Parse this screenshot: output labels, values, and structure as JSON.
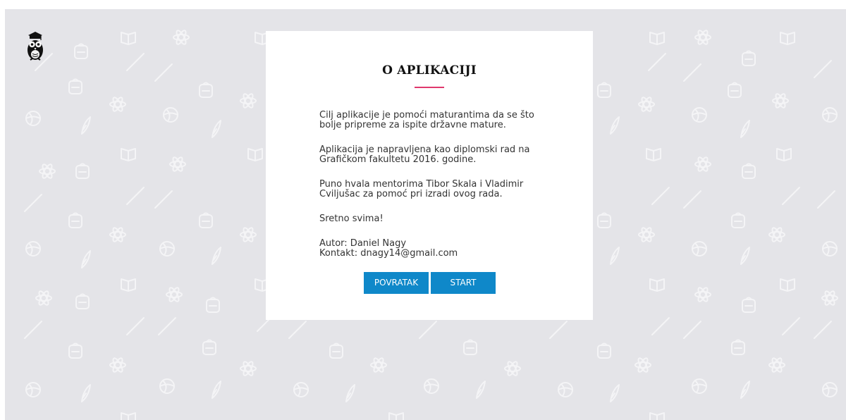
{
  "modal": {
    "title": "O APLIKACIJI",
    "paragraphs": [
      "Cilj aplikacije je pomoći maturantima da se što bolje pripreme za ispite državne mature.",
      "Aplikacija je napravljena kao diplomski rad na Grafičkom fakultetu 2016. godine.",
      "Puno hvala mentorima Tibor Skala i Vladimir Cviljušac za pomoć pri izradi ovog rada.",
      "Sretno svima!"
    ],
    "author": "Autor: Daniel Nagy",
    "contact": "Kontakt: dnagy14@gmail.com",
    "back_label": "POVRATAK",
    "start_label": "START"
  },
  "icons": {
    "logo": "owl-graduate-icon",
    "background": "school-doodle-pattern"
  },
  "colors": {
    "background": "#e4e4e8",
    "accent": "#e0386d",
    "button": "#0f88c9",
    "button_text": "#ffffff"
  }
}
